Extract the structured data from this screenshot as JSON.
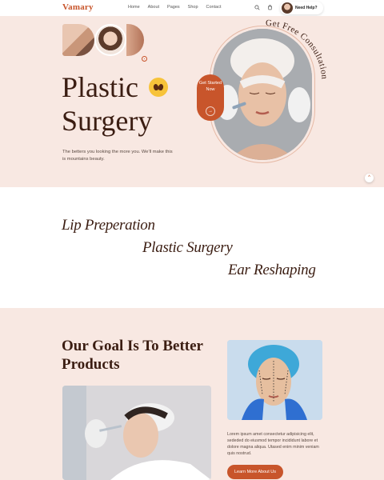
{
  "header": {
    "logo": "Vamary",
    "nav": [
      "Home",
      "About",
      "Pages",
      "Shop",
      "Contact"
    ],
    "help_label": "Need Help?"
  },
  "hero": {
    "title_line1": "Plastic",
    "title_line2": "Surgery",
    "description": "The betters you looking the more you. We'll make this is mountains beauty.",
    "cta_label": "Get Started Now",
    "cta_arrow": "→",
    "arc_text": "Get Free Consultation"
  },
  "services": [
    "Lip Preperation",
    "Plastic Surgery",
    "Ear Reshaping"
  ],
  "about": {
    "title": "Our Goal Is To Better Products",
    "text": "Lorem ipsum amet consectetur adipisicing elit, sededed do eiusmod tempor incididunt labore et dolore magna aliqua. Utased enim minim veniam quis nostrud.",
    "button_label": "Learn More About Us"
  },
  "colors": {
    "accent": "#c8552b",
    "heading": "#3b1d12",
    "hero_bg": "#f8e8e2"
  }
}
